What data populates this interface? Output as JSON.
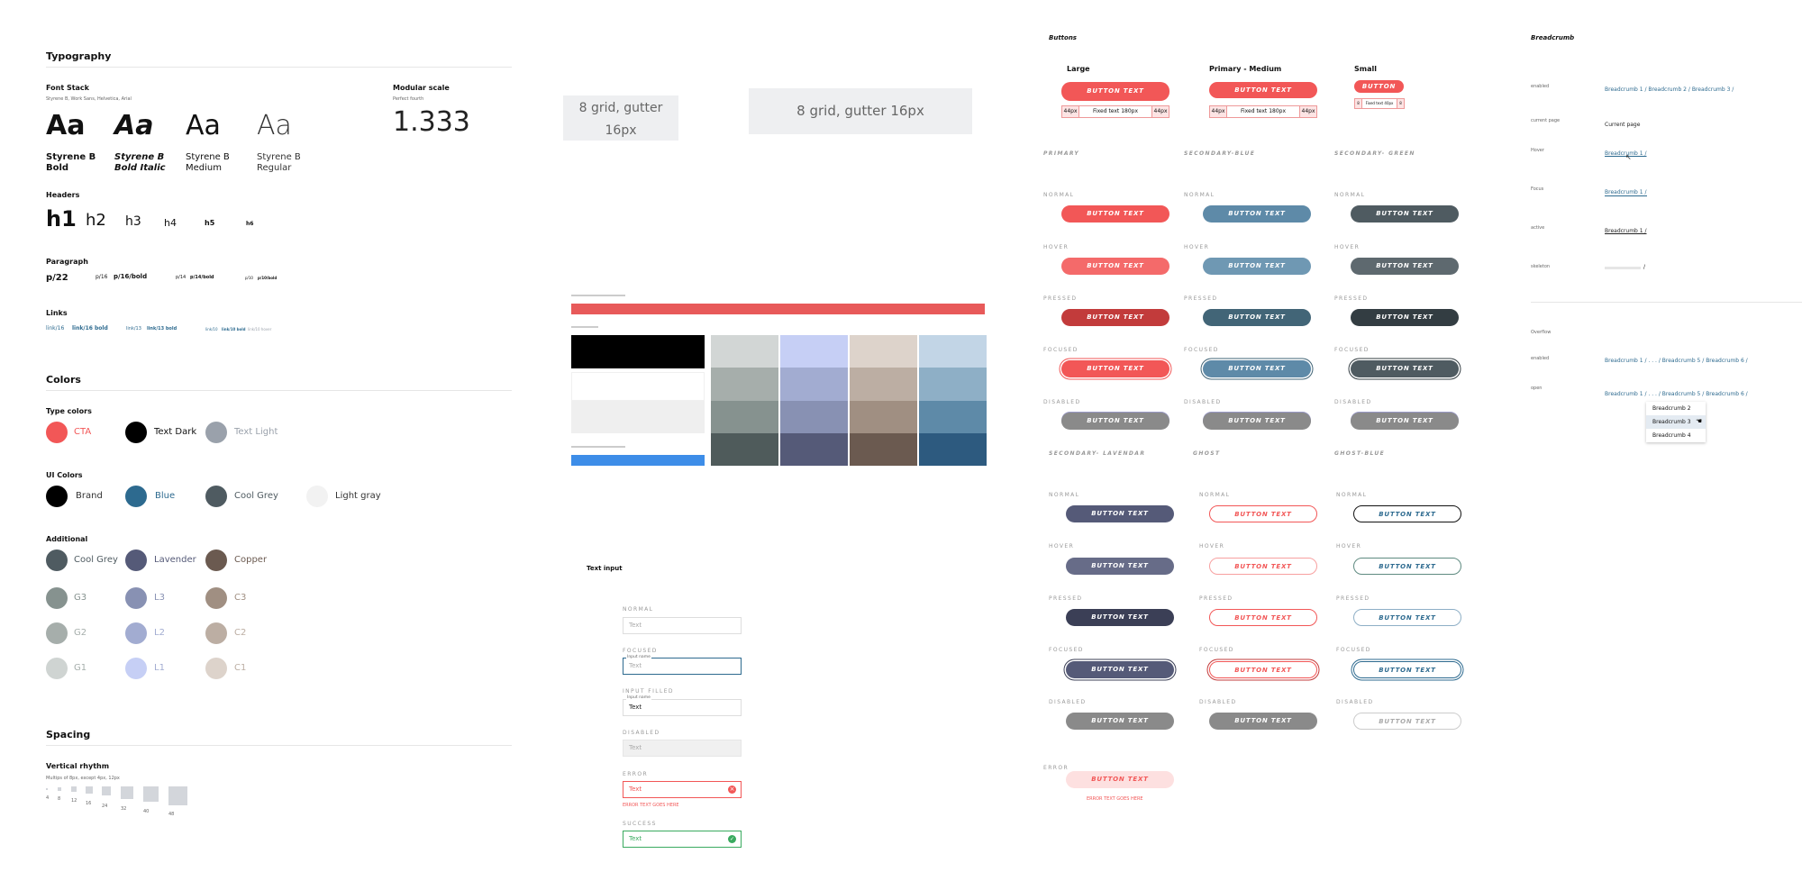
{
  "typography": {
    "title": "Typography",
    "font_stack_label": "Font Stack",
    "font_stack_value": "Styrene B, Work Sans, Helvetica, Arial",
    "aa": "Aa",
    "faces": [
      "Styrene B Bold",
      "Styrene B Bold Italic",
      "Styrene B Medium",
      "Styrene B Regular"
    ],
    "modular_label": "Modular scale",
    "modular_sub": "Perfect fourth",
    "modular_value": "1.333",
    "headers_label": "Headers",
    "headers": [
      "h1",
      "h2",
      "h3",
      "h4",
      "h5",
      "h6"
    ],
    "paragraph_label": "Paragraph",
    "paragraph_items": [
      "p/22",
      "p/16",
      "p/16/bold",
      "p/14",
      "p/14/bold",
      "p/10",
      "p/10/bold"
    ],
    "links_label": "Links",
    "link_items": [
      "link/16",
      "link/16 bold",
      "link/13",
      "link/13 bold",
      "link/10",
      "link/10 bold",
      "link/10 hover"
    ]
  },
  "colors": {
    "title": "Colors",
    "type_label": "Type colors",
    "type_colors": [
      {
        "name": "CTA",
        "hex": "#f25757"
      },
      {
        "name": "Text Dark",
        "hex": "#000000"
      },
      {
        "name": "Text Light",
        "hex": "#9aa1ab"
      }
    ],
    "ui_label": "UI Colors",
    "ui_colors": [
      {
        "name": "Brand",
        "hex": "#000000"
      },
      {
        "name": "Blue",
        "hex": "#2d6a8f"
      },
      {
        "name": "Cool Grey",
        "hex": "#4f5b61"
      },
      {
        "name": "Light gray",
        "hex": "#f2f2f2"
      }
    ],
    "additional_label": "Additional",
    "additional": [
      {
        "name": "Cool Grey",
        "hex": "#4f5b61"
      },
      {
        "name": "Lavender",
        "hex": "#555a78"
      },
      {
        "name": "Copper",
        "hex": "#6b5a50"
      },
      {
        "name": "G3",
        "hex": "#86928f"
      },
      {
        "name": "L3",
        "hex": "#8891b3"
      },
      {
        "name": "C3",
        "hex": "#a08f82"
      },
      {
        "name": "G2",
        "hex": "#a6aeab"
      },
      {
        "name": "L2",
        "hex": "#a2acd1"
      },
      {
        "name": "C2",
        "hex": "#bcaea3"
      },
      {
        "name": "G1",
        "hex": "#cfd4d2"
      },
      {
        "name": "L1",
        "hex": "#c6cff5"
      },
      {
        "name": "C1",
        "hex": "#ddd3cb"
      }
    ]
  },
  "spacing": {
    "title": "Spacing",
    "vr_label": "Vertical rhythm",
    "vr_sub": "Multips of 8px, except 4px, 12px",
    "steps": [
      "4",
      "8",
      "12",
      "16",
      "24",
      "32",
      "40",
      "48"
    ]
  },
  "grid": {
    "a": "8 grid, gutter 16px",
    "b": "8 grid, gutter 16px"
  },
  "buttons": {
    "title": "Buttons",
    "sizes": [
      "Large",
      "Primary - Medium",
      "Small"
    ],
    "btn_text": "BUTTON TEXT",
    "small_btn": "BUTTON",
    "fixed": "Fixed text 180px",
    "fixed_small": "Fixed text 40px",
    "pad": "44px",
    "pad_small": "8",
    "groups1": [
      "PRIMARY",
      "SECONDARY-BLUE",
      "SECONDARY- GREEN"
    ],
    "groups2": [
      "SECONDARY- LAVENDAR",
      "GHOST",
      "GHOST-BLUE"
    ],
    "states": [
      "NORMAL",
      "HOVER",
      "PRESSED",
      "FOCUSED",
      "DISABLED"
    ],
    "error_label": "ERROR",
    "error_msg": "ERROR TEXT GOES HERE"
  },
  "text_input": {
    "title": "Text input",
    "states": [
      "NORMAL",
      "FOCUSED",
      "INPUT FILLED",
      "DISABLED",
      "ERROR",
      "SUCCESS"
    ],
    "placeholder": "Text",
    "float_label": "Input name",
    "filled_value": "Text",
    "error_msg": "ERROR TEXT GOES HERE"
  },
  "breadcrumb": {
    "title": "Breadcrumb",
    "states": [
      "enabled",
      "current page",
      "Hover",
      "Focus",
      "active",
      "skeleton"
    ],
    "trail": "Breadcrumb 1 /  Breadcrumb 2 /  Breadcrumb 3 /",
    "current": "Current page",
    "single": "Breadcrumb 1 /",
    "slash": "/",
    "overflow": "Overflow",
    "overflow_states": [
      "enabled",
      "open"
    ],
    "overflow_trail": "Breadcrumb 1 /  . . .  /  Breadcrumb 5 /  Breadcrumb 6 /",
    "menu": [
      "Breadcrumb 2",
      "Breadcrumb 3",
      "Breadcrumb 4"
    ]
  },
  "accent_colors": {
    "primary": "#f25757",
    "primary_hover": "#f46a6a",
    "primary_pressed": "#c23b3b",
    "blue": "#5e8aa8",
    "blue_dark": "#426577",
    "green": "#4f5b61",
    "green_pressed": "#333d42",
    "lavender": "#555a78",
    "lavender_pressed": "#3b3f56",
    "disabled": "#8a8a8a"
  }
}
